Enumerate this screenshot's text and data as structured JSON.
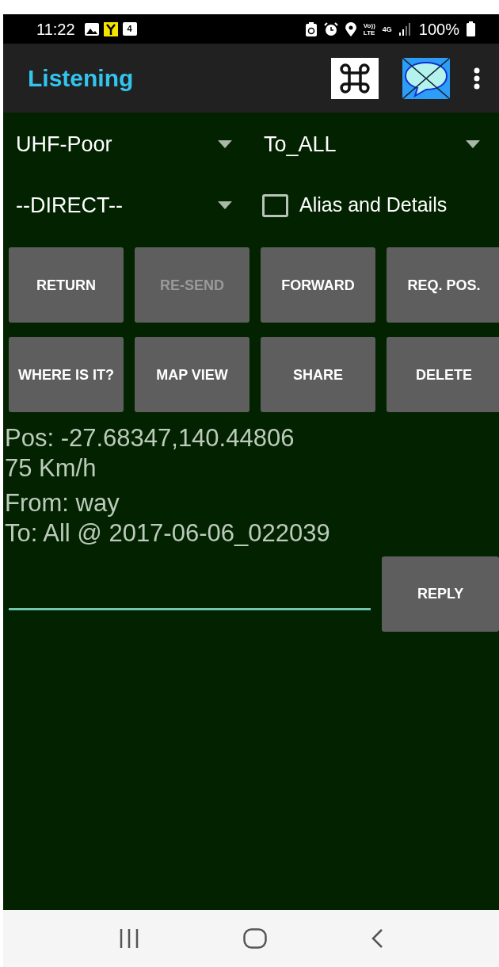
{
  "status_bar": {
    "time": "11:22",
    "calendar_day": "4",
    "volte": [
      "Vo))",
      "LTE"
    ],
    "network": "4G",
    "battery": "100%"
  },
  "app_bar": {
    "title": "Listening"
  },
  "dropdowns": [
    {
      "value": "UHF-Poor"
    },
    {
      "value": "To_ALL"
    },
    {
      "value": "--DIRECT--"
    }
  ],
  "alias_checkbox": {
    "label": "Alias and Details",
    "checked": false
  },
  "buttons": [
    {
      "label": "RETURN",
      "disabled": false
    },
    {
      "label": "RE-SEND",
      "disabled": true
    },
    {
      "label": "FORWARD",
      "disabled": false
    },
    {
      "label": "REQ. POS.",
      "disabled": false
    },
    {
      "label": "WHERE  IS IT?",
      "disabled": false
    },
    {
      "label": "MAP VIEW",
      "disabled": false
    },
    {
      "label": "SHARE",
      "disabled": false
    },
    {
      "label": "DELETE",
      "disabled": false
    }
  ],
  "message": {
    "position": "Pos: -27.68347,140.44806",
    "speed": "75 Km/h",
    "from": "From: way",
    "to": "To: All @ 2017-06-06_022039"
  },
  "reply": {
    "button": "REPLY"
  }
}
